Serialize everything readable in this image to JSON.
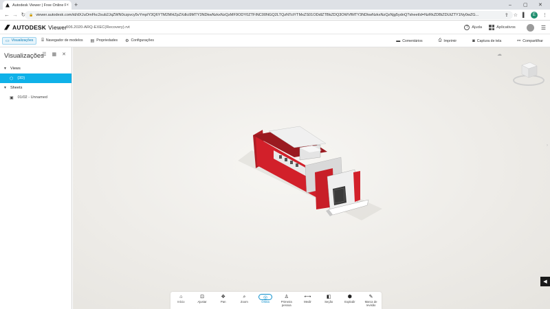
{
  "browser": {
    "tab_title": "Autodesk Viewer | Free Online F",
    "tab_close": "×",
    "new_tab": "+",
    "url": "viewer.autodesk.com/id/dXJuOmFkc2sub2JqZWN0czpvcy5vYmplY3Q6YTM2MHZpZXdlci9MTY3NDkwNzkxNzQzMF9ODY0ZTFiNC00NGQ2LTQzNTctYTMxZS01ODdlZTBkZDQ3OWVfMTY3NDkwNzkxNzQzNjg5ydnQ?sheetId=NzRkZDBiZDUtZTY1Ny0wZG...",
    "win_min": "–",
    "win_max": "▢",
    "win_close": "✕",
    "profile_letter": "E"
  },
  "app": {
    "brand": "AUTODESK",
    "brand_suffix": "Viewer",
    "file_name": "006.2020-ARQ-EXEC(Recovery).rvt",
    "help_label": "Ajuda",
    "apps_label": "Aplicativos"
  },
  "toolbar": {
    "views_label": "Visualizações",
    "model_browser_label": "Navegador de modelos",
    "properties_label": "Propriedades",
    "settings_label": "Configurações",
    "comments_label": "Comentários",
    "print_label": "Imprimir",
    "screenshot_label": "Captura de tela",
    "share_label": "Compartilhar"
  },
  "sidebar": {
    "title": "Visualizações",
    "sections": [
      {
        "label": "Views",
        "items": [
          {
            "label": "{3D}",
            "selected": true
          }
        ]
      },
      {
        "label": "Sheets",
        "items": [
          {
            "label": "01/02 - Unnamed",
            "selected": false
          }
        ]
      }
    ]
  },
  "bottom_toolbar": {
    "items": [
      {
        "label": "Início",
        "icon": "home-icon"
      },
      {
        "label": "Ajustar",
        "icon": "fit-icon"
      },
      {
        "label": "Pan",
        "icon": "pan-icon"
      },
      {
        "label": "Zoom",
        "icon": "zoom-icon"
      },
      {
        "label": "Órbita",
        "icon": "orbit-icon",
        "active": true
      },
      {
        "label": "Primeira pessoa",
        "icon": "first-person-icon"
      },
      {
        "label": "Medir",
        "icon": "measure-icon"
      },
      {
        "label": "Seção",
        "icon": "section-icon"
      },
      {
        "label": "Explodir",
        "icon": "explode-icon"
      },
      {
        "label": "Marca de revisão",
        "icon": "markup-icon"
      }
    ]
  },
  "colors": {
    "accent": "#0fb1e8",
    "model_wall": "#d2202a",
    "model_roof": "#e8e8e8"
  }
}
